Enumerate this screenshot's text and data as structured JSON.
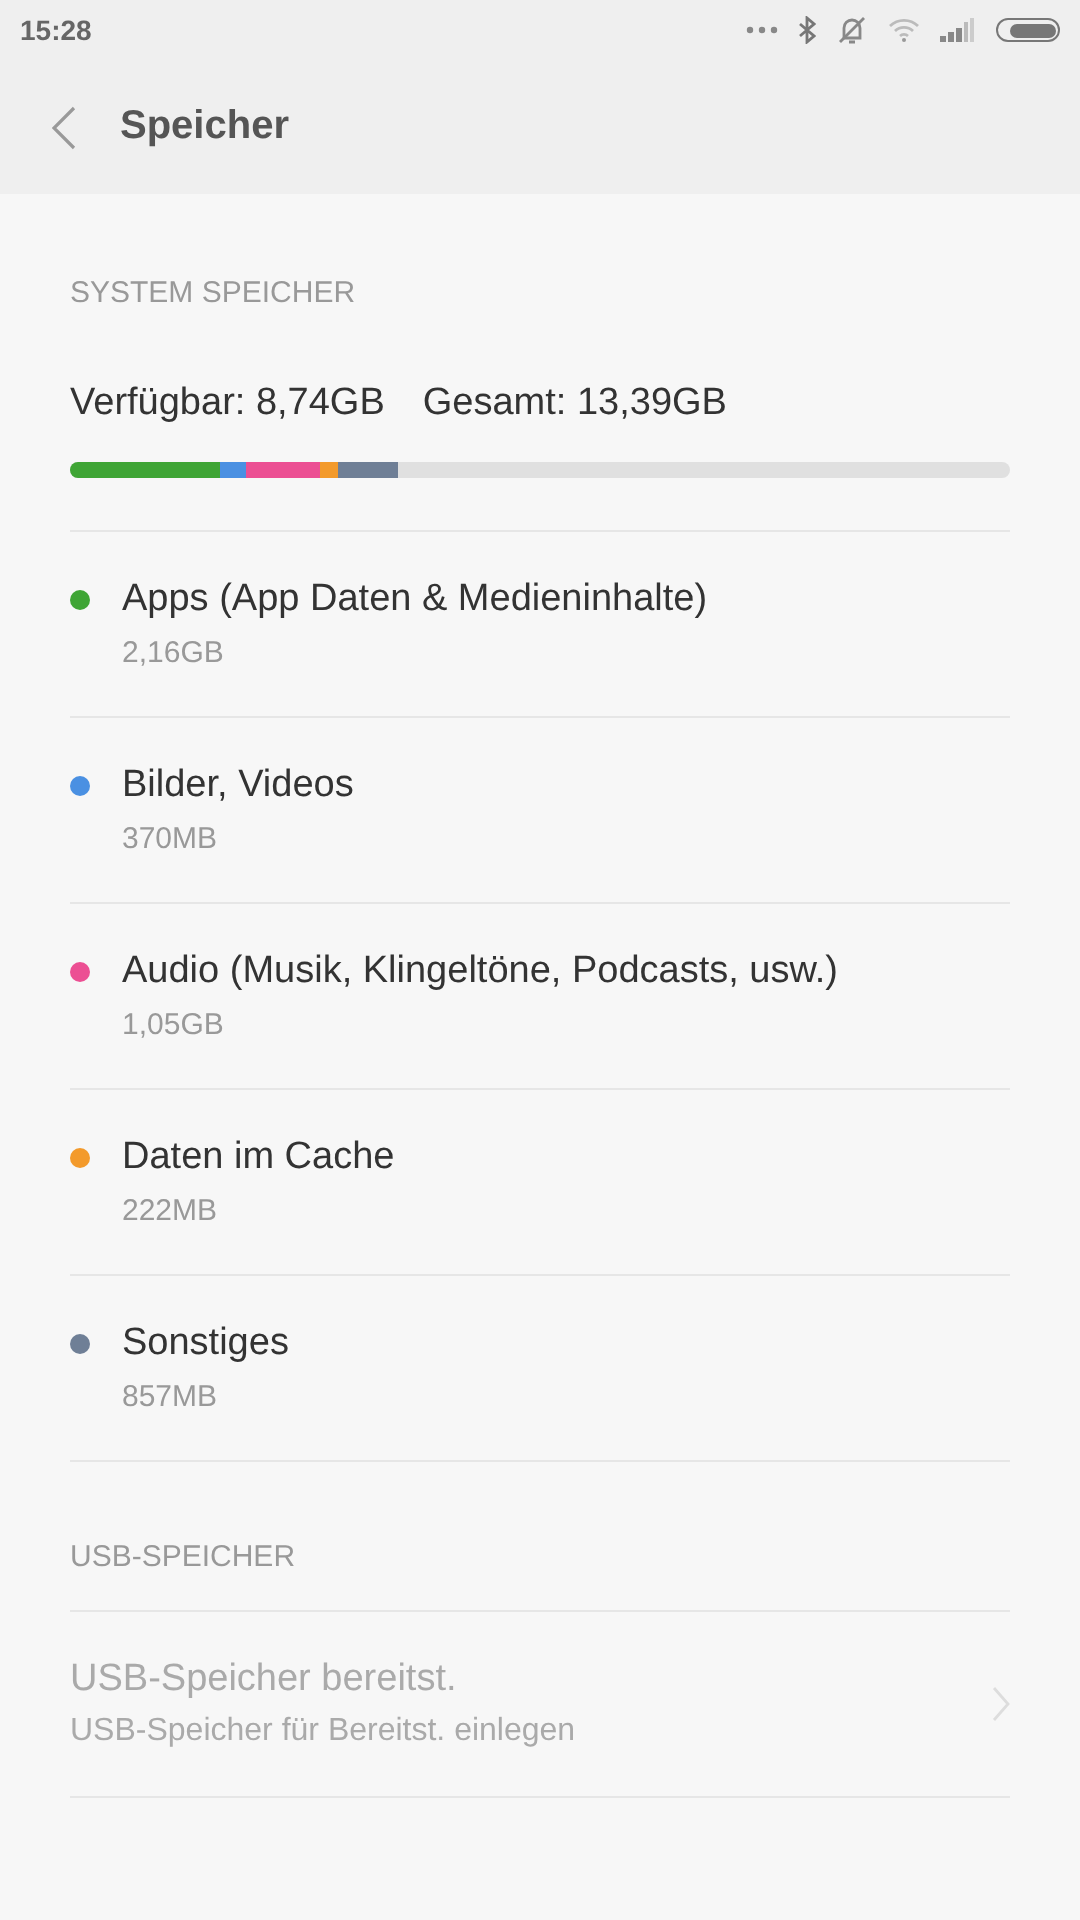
{
  "status_bar": {
    "time": "15:28"
  },
  "header": {
    "title": "Speicher"
  },
  "system_section": {
    "heading": "SYSTEM SPEICHER",
    "available": "Verfügbar: 8,74GB",
    "total": "Gesamt: 13,39GB",
    "segments": [
      {
        "color": "#3fa535"
      },
      {
        "color": "#4a90e2"
      },
      {
        "color": "#ec4f93"
      },
      {
        "color": "#f39a2b"
      },
      {
        "color": "#6f7f96"
      }
    ],
    "items": [
      {
        "title": "Apps (App Daten & Medieninhalte)",
        "size": "2,16GB",
        "color": "#3fa535"
      },
      {
        "title": "Bilder, Videos",
        "size": "370MB",
        "color": "#4a90e2"
      },
      {
        "title": "Audio (Musik, Klingeltöne, Podcasts, usw.)",
        "size": "1,05GB",
        "color": "#ec4f93"
      },
      {
        "title": "Daten im Cache",
        "size": "222MB",
        "color": "#f39a2b"
      },
      {
        "title": "Sonstiges",
        "size": "857MB",
        "color": "#6f7f96"
      }
    ]
  },
  "usb_section": {
    "heading": "USB-SPEICHER",
    "title": "USB-Speicher bereitst.",
    "subtitle": "USB-Speicher für Bereitst. einlegen",
    "disabled": true
  }
}
